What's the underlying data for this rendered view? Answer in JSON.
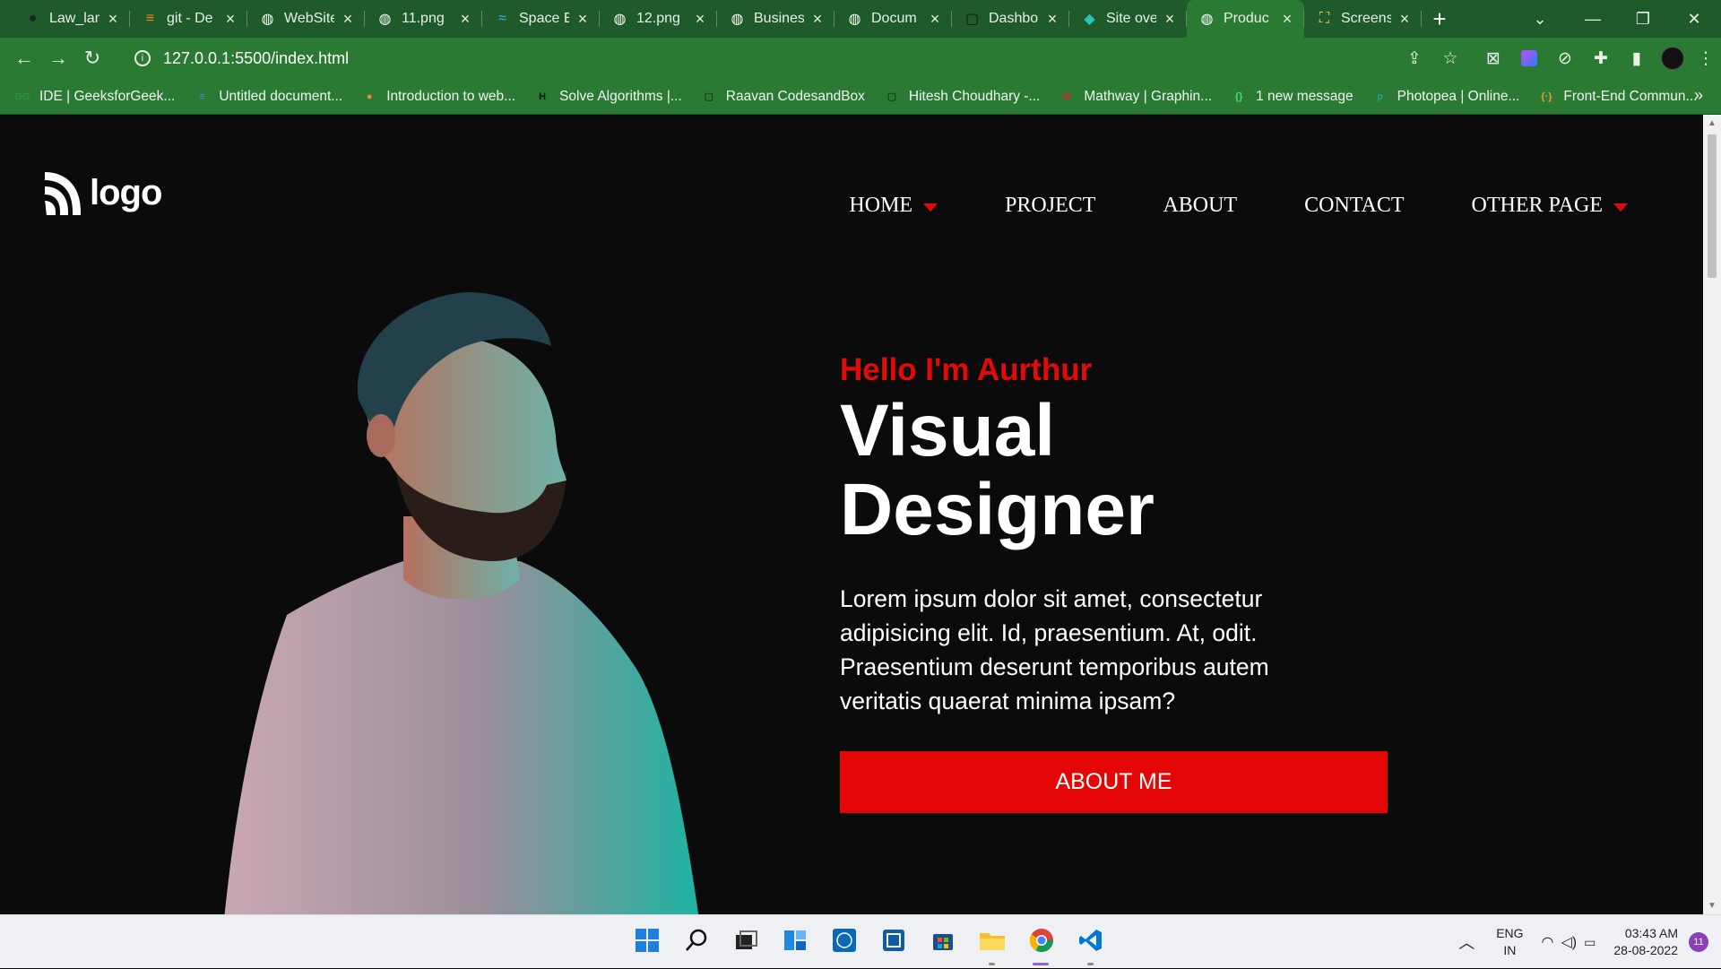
{
  "browser": {
    "tabs": [
      {
        "title": "Law_lan",
        "icon": "github-icon"
      },
      {
        "title": "git - De",
        "icon": "stackoverflow-icon"
      },
      {
        "title": "WebSite",
        "icon": "globe-icon"
      },
      {
        "title": "11.png",
        "icon": "globe-icon"
      },
      {
        "title": "Space E",
        "icon": "tailwind-icon"
      },
      {
        "title": "12.png",
        "icon": "globe-icon"
      },
      {
        "title": "Busines",
        "icon": "globe-icon"
      },
      {
        "title": "Docum",
        "icon": "globe-icon"
      },
      {
        "title": "Dashbo",
        "icon": "square-icon"
      },
      {
        "title": "Site ove",
        "icon": "netlify-icon"
      },
      {
        "title": "Produc",
        "icon": "globe-icon"
      },
      {
        "title": "Screens",
        "icon": "screenshot-icon"
      }
    ],
    "active_tab": 10,
    "close_glyph": "×",
    "new_tab_glyph": "+",
    "url": "127.0.0.1:5500/index.html",
    "bookmarks": [
      {
        "label": "IDE | GeeksforGeek...",
        "icon": "gfg-icon",
        "color": "#2f8d46"
      },
      {
        "label": "Untitled document...",
        "icon": "docs-icon",
        "color": "#4285f4"
      },
      {
        "label": "Introduction to web...",
        "icon": "orange-circle-icon",
        "color": "#f58a1f"
      },
      {
        "label": "Solve Algorithms |...",
        "icon": "hackerrank-icon",
        "color": "#111111"
      },
      {
        "label": "Raavan CodesandBox",
        "icon": "codesandbox-icon",
        "color": "#111111"
      },
      {
        "label": "Hitesh Choudhary -...",
        "icon": "codesandbox-icon",
        "color": "#111111"
      },
      {
        "label": "Mathway | Graphin...",
        "icon": "mathway-icon",
        "color": "#d3263c"
      },
      {
        "label": "1 new message",
        "icon": "braces-icon",
        "color": "#3ddc84"
      },
      {
        "label": "Photopea | Online...",
        "icon": "photopea-icon",
        "color": "#18a497"
      },
      {
        "label": "Front-End Commun...",
        "icon": "frontend-icon",
        "color": "#f0a030"
      }
    ],
    "more_bookmarks": "»"
  },
  "page": {
    "logo_text": "logo",
    "menu": [
      {
        "label": "HOME",
        "has_dropdown": true
      },
      {
        "label": "PROJECT",
        "has_dropdown": false
      },
      {
        "label": "ABOUT",
        "has_dropdown": false
      },
      {
        "label": "CONTACT",
        "has_dropdown": false
      },
      {
        "label": "OTHER PAGE",
        "has_dropdown": true
      }
    ],
    "hero": {
      "greeting": "Hello I'm Aurthur",
      "title_line1": "Visual",
      "title_line2": "Designer",
      "description": "Lorem ipsum dolor sit amet, consectetur adipisicing elit. Id, praesentium. At, odit. Praesentium deserunt temporibus autem veritatis quaerat minima ipsam?",
      "cta_label": "ABOUT ME"
    },
    "colors": {
      "accent": "#e40606",
      "background": "#0b0b0b",
      "text": "#ffffff"
    }
  },
  "taskbar": {
    "apps": [
      "windows-start-icon",
      "search-icon",
      "task-view-icon",
      "widgets-icon",
      "dell-icon",
      "remote-icon",
      "store-icon",
      "file-explorer-icon",
      "chrome-icon",
      "vscode-icon"
    ],
    "language_top": "ENG",
    "language_bottom": "IN",
    "time": "03:43 AM",
    "date": "28-08-2022",
    "notification_count": "11"
  }
}
